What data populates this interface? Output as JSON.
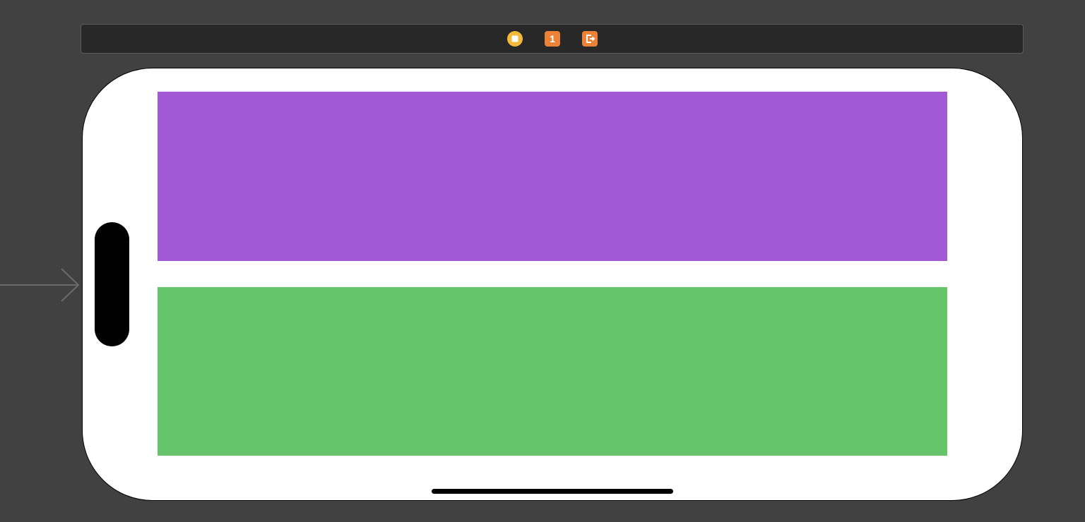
{
  "scene_dock": {
    "items": [
      {
        "name": "view-controller-icon",
        "color": "#F5B93A",
        "label": ""
      },
      {
        "name": "first-responder-icon",
        "color": "#EC8237",
        "label": "1"
      },
      {
        "name": "exit-icon",
        "color": "#EC8237",
        "label": ""
      }
    ]
  },
  "entry_point": {
    "icon": "arrow-right-icon",
    "color": "#6b6b6b"
  },
  "device": {
    "orientation": "landscape",
    "background": "#FFFFFF",
    "views": [
      {
        "name": "purple-view",
        "color": "#A259D6"
      },
      {
        "name": "green-view",
        "color": "#66C56A"
      }
    ]
  }
}
